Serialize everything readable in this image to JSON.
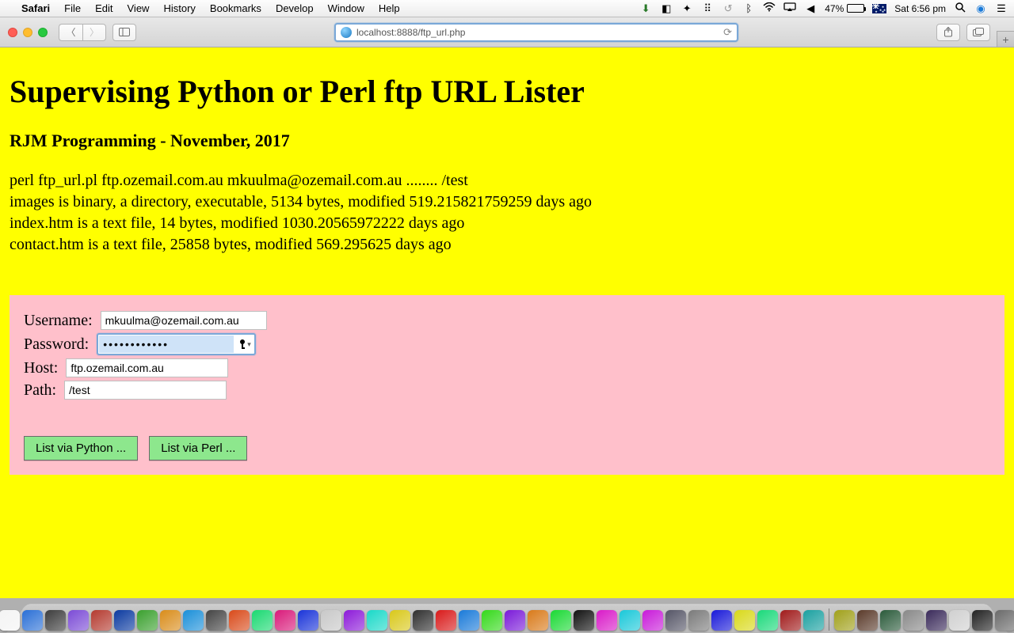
{
  "menubar": {
    "app_name": "Safari",
    "items": [
      "File",
      "Edit",
      "View",
      "History",
      "Bookmarks",
      "Develop",
      "Window",
      "Help"
    ],
    "battery_pct": "47%",
    "clock": "Sat 6:56 pm"
  },
  "toolbar": {
    "url": "localhost:8888/ftp_url.php"
  },
  "page": {
    "title": "Supervising Python or Perl ftp URL Lister",
    "subtitle": "RJM Programming - November, 2017",
    "output_lines": [
      "perl ftp_url.pl ftp.ozemail.com.au mkuulma@ozemail.com.au ........ /test",
      "images is binary, a directory, executable, 5134 bytes, modified 519.215821759259 days ago",
      "index.htm is a text file, 14 bytes, modified 1030.20565972222 days ago",
      "contact.htm is a text file, 25858 bytes, modified 569.295625 days ago"
    ],
    "form": {
      "username_label": "Username:",
      "username_value": "mkuulma@ozemail.com.au",
      "password_label": "Password:",
      "password_value": "••••••••••••",
      "host_label": "Host:",
      "host_value": "ftp.ozemail.com.au",
      "path_label": "Path:",
      "path_value": "/test",
      "btn_python": "List via Python ...",
      "btn_perl": "List via Perl ..."
    }
  },
  "dock": {
    "apps": [
      "#f4f4f4",
      "#2a6fd6",
      "#3c3c3c",
      "#7b4bd6",
      "#b43a2f",
      "#0b3aa0",
      "#3aa02e",
      "#d98c1a",
      "#1a8fd9",
      "#444",
      "#d94a1a",
      "#1ad971",
      "#d91a7a",
      "#1a34d9",
      "#c8c8c8",
      "#8c1ad9",
      "#1ad9c8",
      "#d9c81a",
      "#2f2f2f",
      "#d91a1a",
      "#1a7ad9",
      "#34d91a",
      "#7a1ad9",
      "#d97a1a",
      "#1ad934",
      "#111",
      "#d91ac8",
      "#1ac8d9",
      "#c81ad9",
      "#556",
      "#7a7a7a",
      "#1a1ad9",
      "#d9d91a",
      "#1ad97a",
      "#a01a1a",
      "#1aa0a0",
      "#a0a01a",
      "#5a3a2a",
      "#2a5a3a",
      "#888",
      "#3a2a5a",
      "#d0d0d0",
      "#222",
      "#6a6a6a"
    ]
  }
}
